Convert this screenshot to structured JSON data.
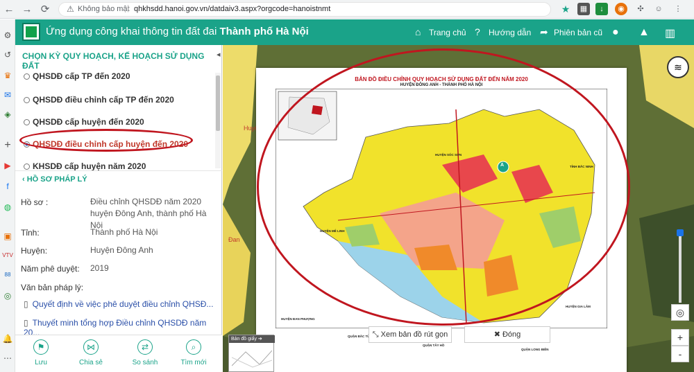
{
  "browser": {
    "security_label": "Không bảo mật",
    "url": "qhkhsdd.hanoi.gov.vn/datdaiv3.aspx?orgcode=hanoistnmt"
  },
  "app": {
    "title_prefix": "Ứng dụng công khai thông tin đất đai",
    "title_bold": "Thành phố Hà Nội",
    "nav": {
      "home": "Trang chủ",
      "help": "Hướng dẫn",
      "old_version": "Phiên bản cũ"
    }
  },
  "panel": {
    "section_title": "CHỌN KỲ QUY HOẠCH, KẾ HOẠCH SỬ DỤNG ĐẤT",
    "options": [
      {
        "label": "QHSDĐ cấp TP đến 2020",
        "selected": false
      },
      {
        "label": "QHSDĐ điều chỉnh cấp TP đến 2020",
        "selected": false
      },
      {
        "label": "QHSDĐ cấp huyện đến 2020",
        "selected": false
      },
      {
        "label": "QHSDĐ điều chỉnh cấp huyện đến 2020",
        "selected": true
      },
      {
        "label": "KHSDĐ cấp huyện năm 2020",
        "selected": false
      }
    ],
    "legal_title": "HỒ SƠ PHÁP LÝ",
    "fields": {
      "hoso_label": "Hồ sơ :",
      "hoso_value": "Điều chỉnh QHSDĐ năm 2020 huyện Đông Anh, thành phố Hà Nội",
      "tinh_label": "Tỉnh:",
      "tinh_value": "Thành phố Hà Nội",
      "huyen_label": "Huyện:",
      "huyen_value": "Huyện Đông Anh",
      "nam_label": "Năm phê duyệt:",
      "nam_value": "2019",
      "vanban_label": "Văn bản pháp lý:"
    },
    "documents": [
      "Quyết định về việc phê duyệt điều chỉnh QHSĐ...",
      "Thuyết minh tổng hợp Điều chỉnh QHSDĐ năm 20..."
    ],
    "actions": {
      "save": "Lưu",
      "share": "Chia sẻ",
      "compare": "So sánh",
      "search": "Tìm mới"
    }
  },
  "map": {
    "plan_title": "BẢN ĐỒ ĐIỀU CHỈNH QUY HOẠCH SỬ DỤNG ĐẤT ĐẾN NĂM 2020",
    "plan_subtitle": "HUYỆN ĐÔNG ANH - THÀNH PHỐ HÀ NỘI",
    "labels": {
      "soc_son": "HUYỆN SÓC SƠN",
      "bac_ninh": "TỈNH BẮC NINH",
      "me_linh": "HUYỆN MÊ LINH",
      "gia_lam": "HUYỆN GIA LÂM",
      "dan_phuong": "HUYỆN ĐAN PHƯỢNG",
      "bac_tu_liem": "QUẬN BẮC TỪ LIÊM",
      "tay_ho": "QUẬN TÂY HỒ",
      "long_bien": "QUẬN LONG BIÊN"
    },
    "bg_label_huye": "Huyệ",
    "bg_label_dan": "Đan",
    "marker": "A",
    "paper_map_label": "Bản đồ giấy",
    "btn_collapse": "Xem bản đồ rút gọn",
    "btn_close": "Đóng",
    "zoom_in": "+",
    "zoom_out": "-"
  },
  "colors": {
    "header_green": "#1aa389",
    "highlight_red": "#c0161f"
  }
}
